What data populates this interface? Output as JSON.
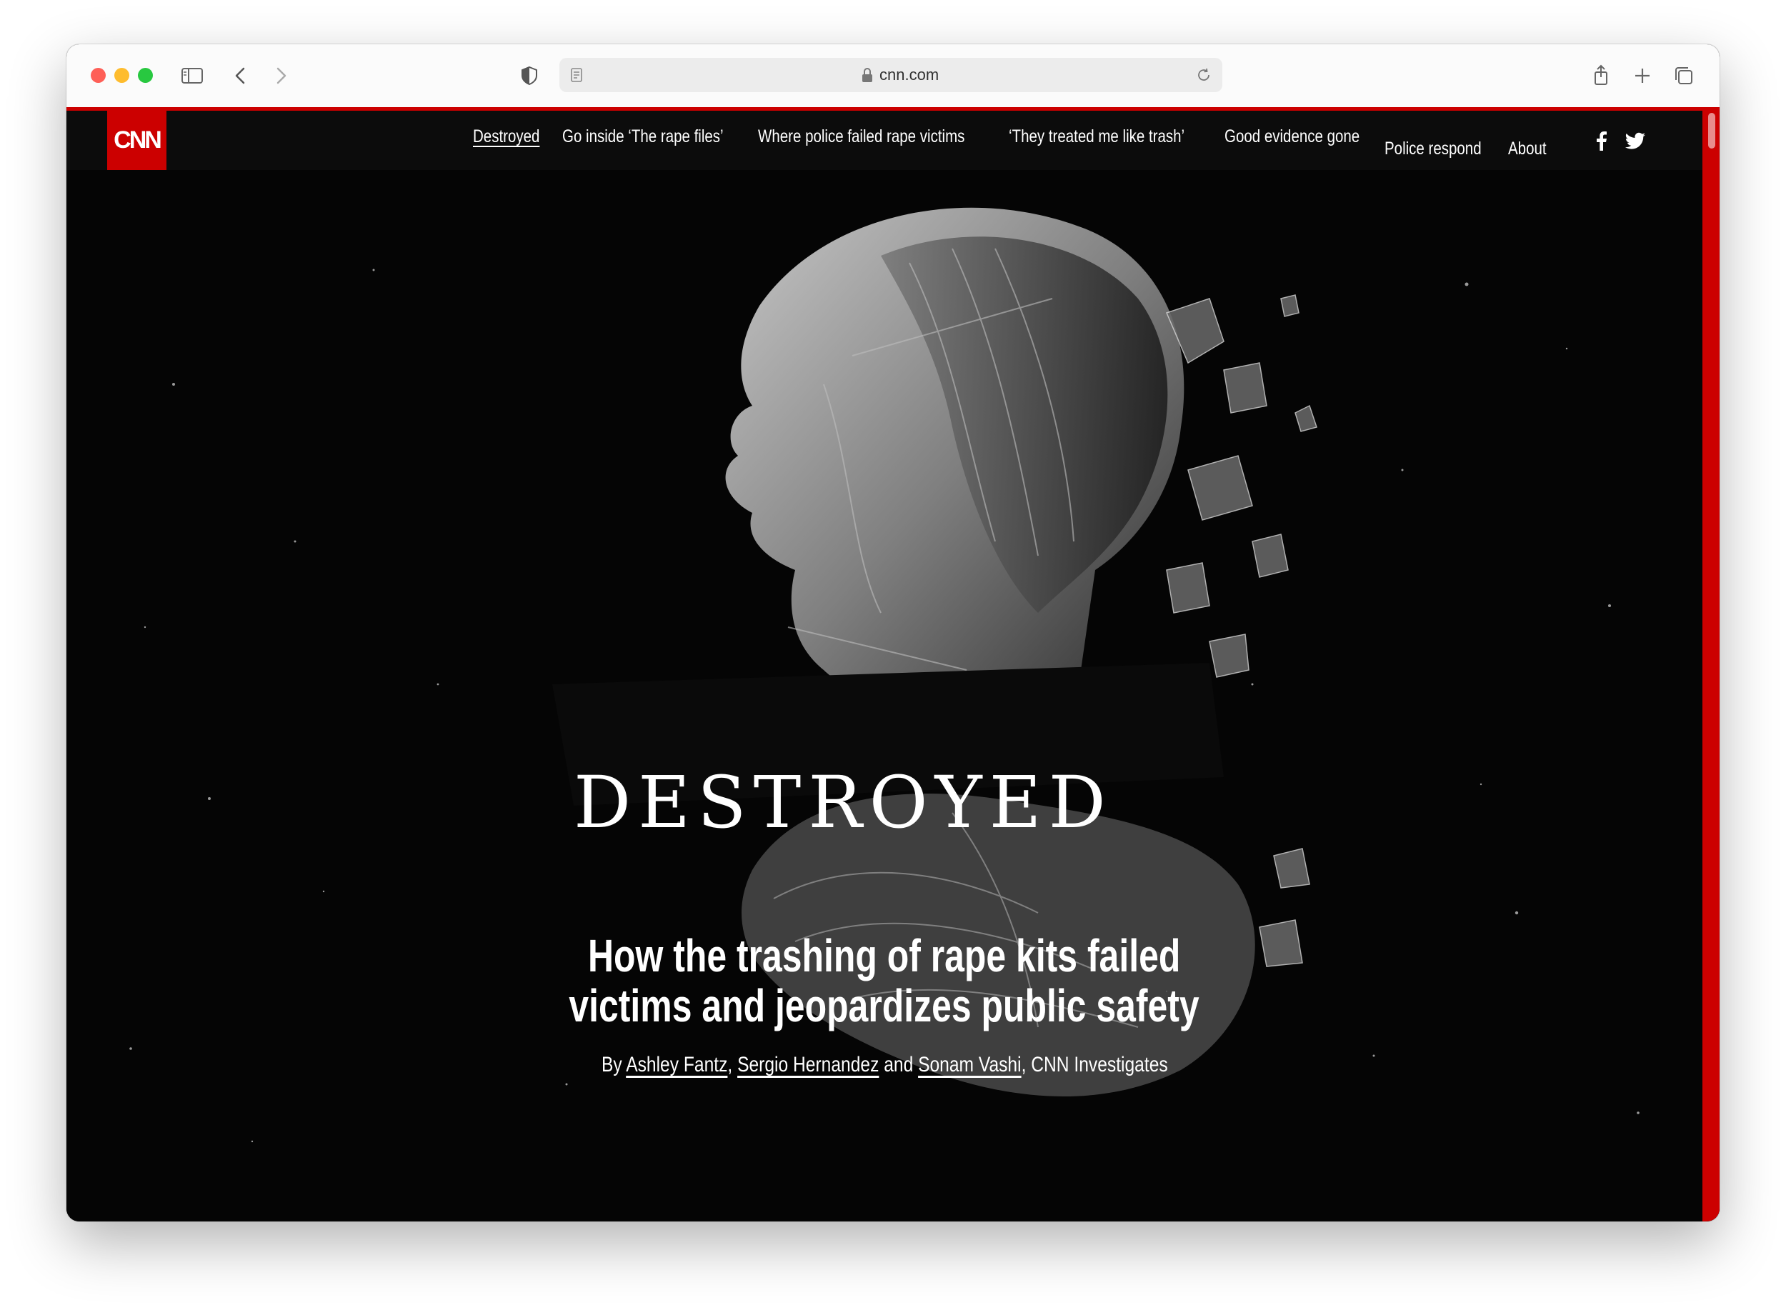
{
  "browser": {
    "url": "cnn.com",
    "icons": [
      "sidebar-icon",
      "back-icon",
      "forward-icon",
      "shield-icon",
      "page-icon",
      "lock-icon",
      "reload-icon",
      "share-icon",
      "new-tab-icon",
      "tabs-icon"
    ]
  },
  "site": {
    "logo": "CNN",
    "nav": [
      {
        "label": "Destroyed",
        "active": true
      },
      {
        "label": "Go inside ‘The rape files’"
      },
      {
        "label": "Where police failed rape victims"
      },
      {
        "label": "‘They treated me like trash’"
      },
      {
        "label": "Good evidence gone"
      },
      {
        "label": "Police respond"
      },
      {
        "label": "About"
      }
    ],
    "social": [
      "facebook-icon",
      "twitter-icon"
    ],
    "accent": "#cc0000"
  },
  "hero": {
    "title_art": "DESTROYED",
    "headline_line1": "How the trashing of rape kits failed",
    "headline_line2": "victims and jeopardizes public safety",
    "byline": {
      "prefix": "By ",
      "author1": "Ashley Fantz",
      "sep1": ", ",
      "author2": "Sergio Hernandez",
      "sep2": " and ",
      "author3": "Sonam Vashi",
      "suffix": ", CNN Investigates"
    }
  }
}
